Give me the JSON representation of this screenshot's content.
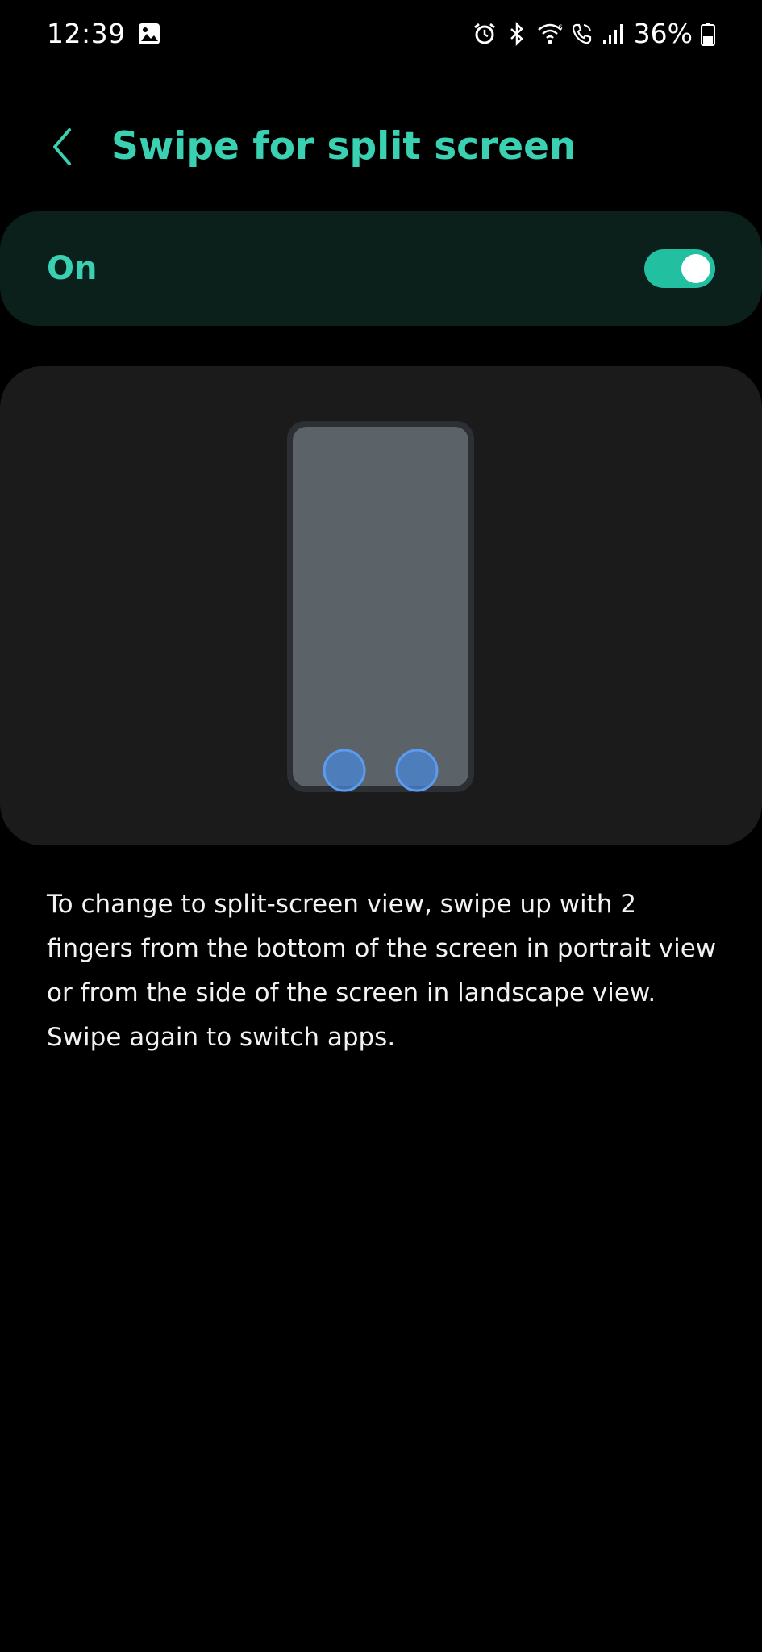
{
  "status_bar": {
    "time": "12:39",
    "battery": "36%",
    "icons": [
      "gallery-icon",
      "alarm-icon",
      "bluetooth-icon",
      "wifi-icon",
      "wifi-calling-icon",
      "signal-icon",
      "battery-icon"
    ]
  },
  "header": {
    "title": "Swipe for split screen",
    "back_icon": "chevron-left-icon"
  },
  "toggle": {
    "label": "On",
    "state": true
  },
  "illustration": {
    "description_icon": "phone-two-finger-swipe-illustration"
  },
  "description": "To change to split-screen view, swipe up with 2 fingers from the bottom of the screen in portrait view or from the side of the screen in landscape view. Swipe again to switch apps.",
  "colors": {
    "accent": "#3ad1b3",
    "switch_on": "#22bfa0",
    "toggle_card_bg": "#0b1f1b",
    "illustration_card_bg": "#1b1b1b",
    "page_bg": "#000000",
    "finger_dot": "#4a86d8"
  }
}
